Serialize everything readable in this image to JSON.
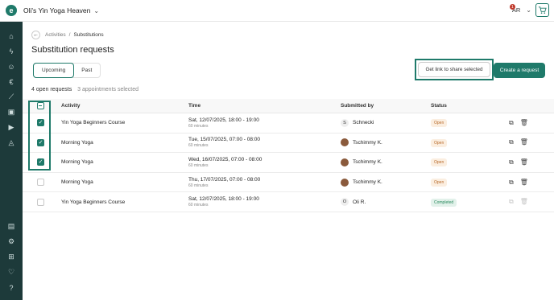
{
  "app": {
    "studio_name": "Oli's Yin Yoga Heaven",
    "user_initials": "AR",
    "notification_count": "1"
  },
  "sidebar": {
    "icons": [
      "home-icon",
      "bolt-icon",
      "person-icon",
      "euro-icon",
      "chart-icon",
      "box-icon",
      "play-icon",
      "megaphone-icon"
    ],
    "bottom_icons": [
      "book-icon",
      "gear-icon",
      "plus-box-icon",
      "heart-icon",
      "help-icon"
    ]
  },
  "breadcrumb": {
    "parent": "Activities",
    "separator": "/",
    "current": "Substitutions"
  },
  "page": {
    "title": "Substitution requests"
  },
  "tabs": [
    {
      "label": "Upcoming",
      "active": true
    },
    {
      "label": "Past",
      "active": false
    }
  ],
  "actions": {
    "share_link": "Get link to share selected",
    "create": "Create a request"
  },
  "summary": {
    "open_count": "4 open requests",
    "selected": "3 appointments selected"
  },
  "table": {
    "headers": {
      "activity": "Activity",
      "time": "Time",
      "submitted_by": "Submitted by",
      "status": "Status"
    },
    "rows": [
      {
        "checked": true,
        "activity": "Yin Yoga Beginners Course",
        "time": "Sat, 12/07/2025, 18:00 - 19:00",
        "duration": "60 minutes",
        "submitter": "Schnecki",
        "initial": "S",
        "status": "Open"
      },
      {
        "checked": true,
        "activity": "Morning Yoga",
        "time": "Tue, 15/07/2025, 07:00 - 08:00",
        "duration": "60 minutes",
        "submitter": "Tschimmy K.",
        "initial": "",
        "status": "Open"
      },
      {
        "checked": true,
        "activity": "Morning Yoga",
        "time": "Wed, 16/07/2025, 07:00 - 08:00",
        "duration": "60 minutes",
        "submitter": "Tschimmy K.",
        "initial": "",
        "status": "Open"
      },
      {
        "checked": false,
        "activity": "Morning Yoga",
        "time": "Thu, 17/07/2025, 07:00 - 08:00",
        "duration": "60 minutes",
        "submitter": "Tschimmy K.",
        "initial": "",
        "status": "Open"
      },
      {
        "checked": false,
        "activity": "Yin Yoga Beginners Course",
        "time": "Sat, 12/07/2025, 18:00 - 19:00",
        "duration": "60 minutes",
        "submitter": "Oli R.",
        "initial": "O",
        "status": "Completed"
      }
    ]
  },
  "colors": {
    "brand": "#1f7a6a",
    "sidebar": "#1d3a3a",
    "open_badge": "#fbeee0",
    "completed_badge": "#e2f1ea"
  }
}
